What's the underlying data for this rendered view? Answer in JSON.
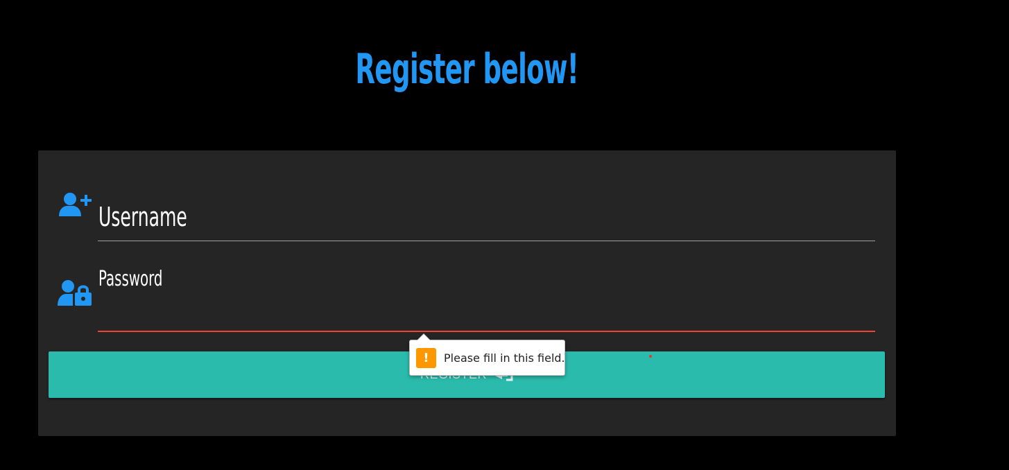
{
  "page": {
    "title": "Register below!"
  },
  "form": {
    "username_label": "Username",
    "username_value": "",
    "password_label": "Password",
    "password_value": "",
    "username_icon": "user-plus-icon",
    "password_icon": "user-lock-icon",
    "register_label": "REGISTER",
    "register_icon": "send-icon"
  },
  "validation": {
    "message": "Please fill in this field.",
    "icon": "warning-icon"
  },
  "colors": {
    "accent": "#2196f3",
    "button": "#2bbbad",
    "card": "#252525",
    "background": "#000000",
    "error": "#f44336",
    "warning": "#ff9800"
  }
}
